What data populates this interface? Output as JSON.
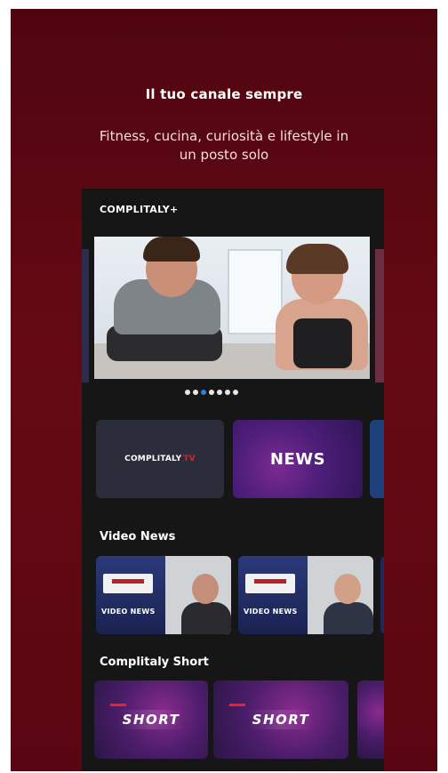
{
  "promo": {
    "headline": "Il tuo canale sempre",
    "subline": "Fitness, cucina, curiosità e lifestyle in un posto solo"
  },
  "app": {
    "brand": "COMPLITALY+",
    "carousel": {
      "total_slides": 7,
      "active_index": 2
    },
    "tiles": {
      "tv_label": "COMPLITALY",
      "tv_suffix": "TV",
      "news_label": "NEWS"
    },
    "video_news": {
      "title": "Video News",
      "items": [
        {
          "label": "VIDEO NEWS"
        },
        {
          "label": "VIDEO NEWS"
        }
      ]
    },
    "short": {
      "title": "Complitaly Short",
      "items": [
        {
          "label": "SHORT"
        },
        {
          "label": "SHORT"
        }
      ]
    }
  },
  "colors": {
    "background": "#5a0612",
    "app_bg": "#161617",
    "accent_red": "#e01e2e",
    "active_dot": "#2f7fd6"
  }
}
